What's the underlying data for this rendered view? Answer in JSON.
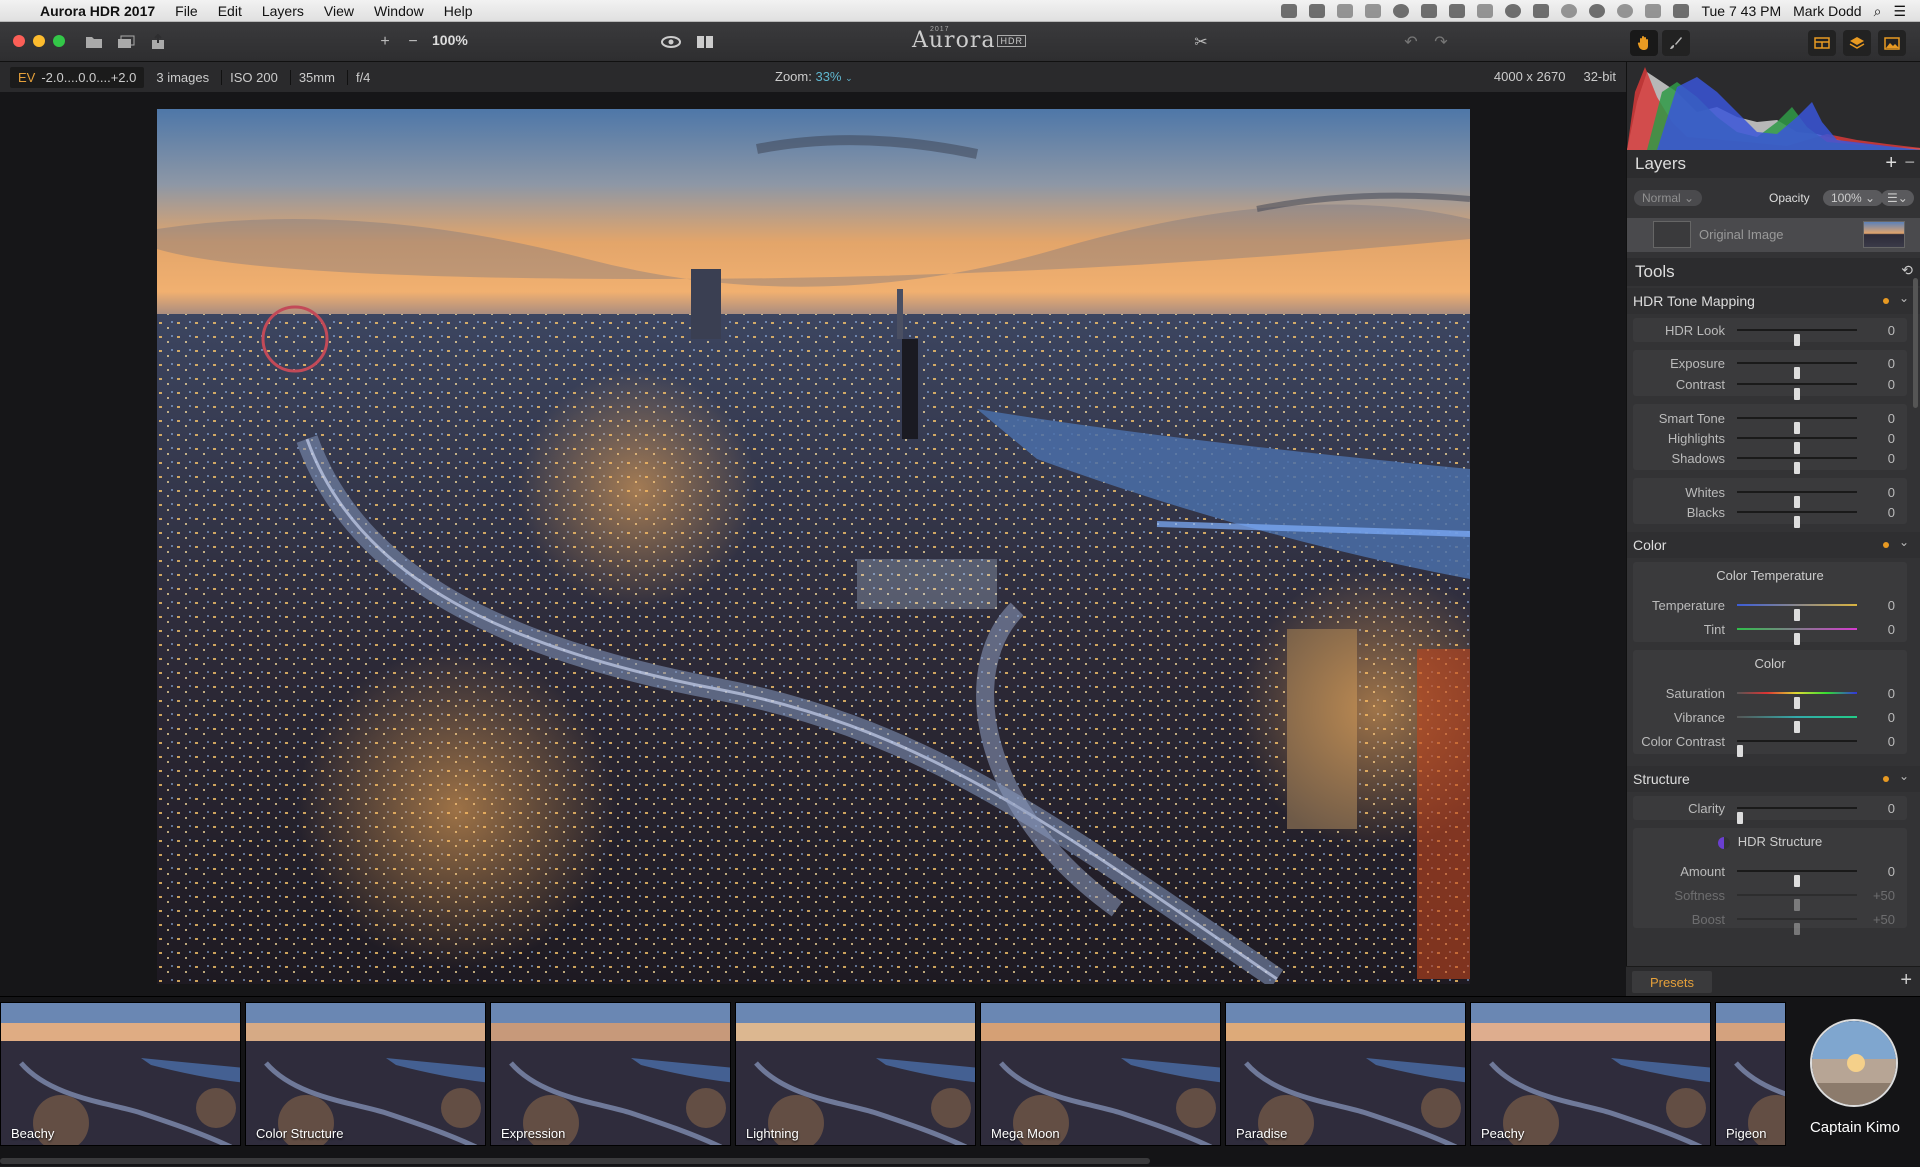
{
  "menubar": {
    "app_name": "Aurora HDR 2017",
    "menus": [
      "File",
      "Edit",
      "Layers",
      "View",
      "Window",
      "Help"
    ],
    "clock": "Tue 7 43 PM",
    "user": "Mark Dodd"
  },
  "toolbar": {
    "zoom_pct": "100%",
    "logo_text": "Aurora",
    "logo_badge": "HDR",
    "logo_year": "2017"
  },
  "infobar": {
    "ev_label": "EV",
    "ev_range": "-2.0....0.0....+2.0",
    "images": "3 images",
    "iso": "ISO 200",
    "focal": "35mm",
    "aperture": "f/4",
    "zoom_label": "Zoom:",
    "zoom_value": "33%",
    "dimensions": "4000 x 2670",
    "bitdepth": "32-bit"
  },
  "layers": {
    "title": "Layers",
    "blend_mode": "Normal",
    "opacity_label": "Opacity",
    "opacity_value": "100%",
    "layer_name": "Original Image"
  },
  "tools": {
    "title": "Tools",
    "hdr": {
      "title": "HDR Tone Mapping",
      "sliders": [
        {
          "label": "HDR Look",
          "value": "0",
          "pos": 0.5
        },
        {
          "label": "Exposure",
          "value": "0",
          "pos": 0.5
        },
        {
          "label": "Contrast",
          "value": "0",
          "pos": 0.5
        },
        {
          "label": "Smart Tone",
          "value": "0",
          "pos": 0.5
        },
        {
          "label": "Highlights",
          "value": "0",
          "pos": 0.5
        },
        {
          "label": "Shadows",
          "value": "0",
          "pos": 0.5
        },
        {
          "label": "Whites",
          "value": "0",
          "pos": 0.5
        },
        {
          "label": "Blacks",
          "value": "0",
          "pos": 0.5
        }
      ]
    },
    "color": {
      "title": "Color",
      "temp_header": "Color Temperature",
      "color_header": "Color",
      "sliders": [
        {
          "label": "Temperature",
          "value": "0",
          "pos": 0.5
        },
        {
          "label": "Tint",
          "value": "0",
          "pos": 0.5
        },
        {
          "label": "Saturation",
          "value": "0",
          "pos": 0.5
        },
        {
          "label": "Vibrance",
          "value": "0",
          "pos": 0.5
        },
        {
          "label": "Color Contrast",
          "value": "0",
          "pos": 0.0
        }
      ]
    },
    "structure": {
      "title": "Structure",
      "hdr_structure": "HDR Structure",
      "sliders": [
        {
          "label": "Clarity",
          "value": "0",
          "pos": 0.0
        },
        {
          "label": "Amount",
          "value": "0",
          "pos": 0.5
        },
        {
          "label": "Softness",
          "value": "+50",
          "pos": 0.5
        },
        {
          "label": "Boost",
          "value": "+50",
          "pos": 0.5
        }
      ]
    }
  },
  "presets": {
    "tab_label": "Presets",
    "items": [
      "Beachy",
      "Color Structure",
      "Expression",
      "Lightning",
      "Mega Moon",
      "Paradise",
      "Peachy",
      "Pigeon"
    ],
    "author": "Captain Kimo"
  },
  "colors": {
    "accent_orange": "#e89a22",
    "accent_teal": "#5fb6cf"
  }
}
